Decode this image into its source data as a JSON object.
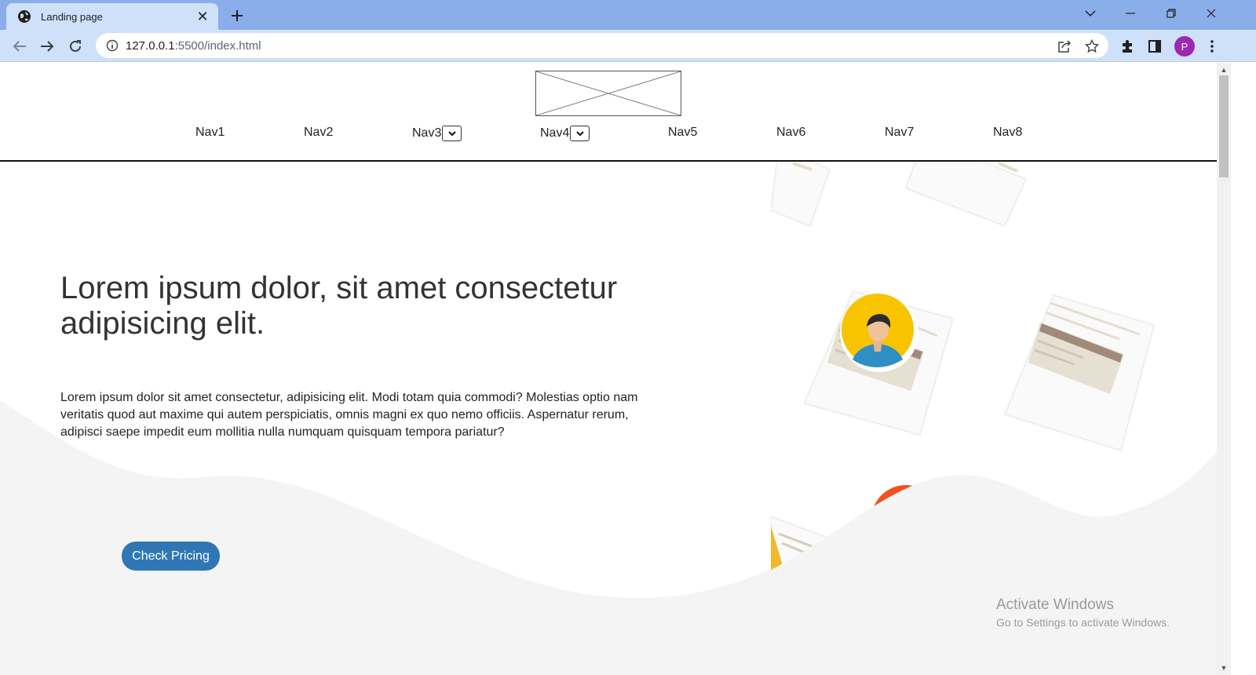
{
  "browser": {
    "tab_title": "Landing page",
    "url_host": "127.0.0.1",
    "url_rest": ":5500/index.html",
    "profile_initial": "P"
  },
  "page": {
    "nav": [
      "Nav1",
      "Nav2",
      "Nav3",
      "Nav4",
      "Nav5",
      "Nav6",
      "Nav7",
      "Nav8"
    ],
    "hero_title": "Lorem ipsum dolor, sit amet consectetur adipisicing elit.",
    "hero_text": "Lorem ipsum dolor sit amet consectetur, adipisicing elit. Modi totam quia commodi? Molestias optio nam veritatis quod aut maxime qui autem perspiciatis, omnis magni ex quo nemo officiis. Aspernatur rerum, adipisci saepe impedit eum mollitia nulla numquam quisquam tempora pariatur?",
    "cta_label": "Check Pricing"
  },
  "watermark": {
    "line1": "Activate Windows",
    "line2": "Go to Settings to activate Windows."
  },
  "colors": {
    "tabbar": "#8aaeea",
    "toolbar": "#cfe0f9",
    "cta": "#2f77b4",
    "wave": "#f4f4f4",
    "avatar": "#9c27b0"
  }
}
